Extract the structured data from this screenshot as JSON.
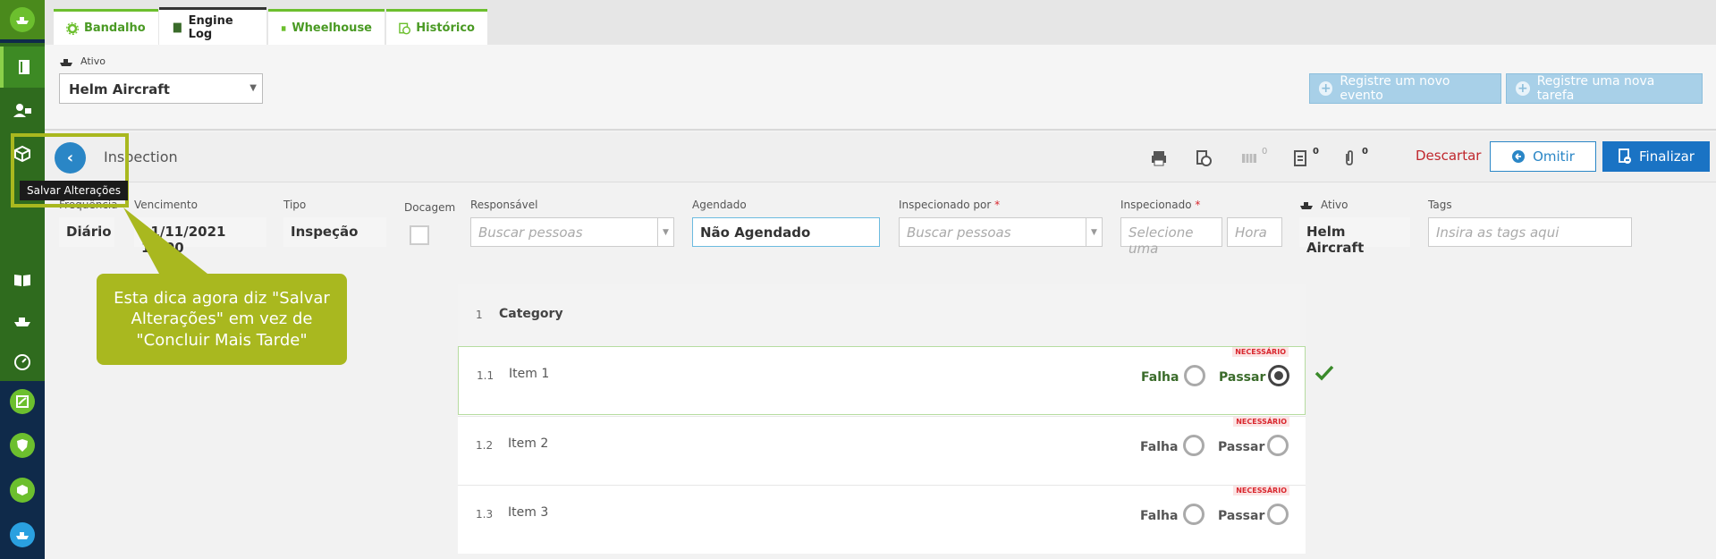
{
  "tabs": [
    {
      "label": "Bandalho",
      "icon": "gear-icon"
    },
    {
      "label": "Engine Log",
      "icon": "book-icon"
    },
    {
      "label": "Wheelhouse",
      "icon": "book-icon"
    },
    {
      "label": "Histórico",
      "icon": "history-icon"
    }
  ],
  "asset_bar": {
    "label": "Ativo",
    "selected": "Helm Aircraft",
    "new_event": "Registre um novo evento",
    "new_task": "Registre uma nova tarefa"
  },
  "header": {
    "title": "Inspection",
    "counts": [
      "0",
      "0",
      "0"
    ],
    "discard": "Descartar",
    "omit": "Omitir",
    "finish": "Finalizar"
  },
  "fields": {
    "freq_label": "Frequência",
    "freq_value": "Diário",
    "due_label": "Vencimento",
    "due_value": "11/11/2021 12:00",
    "type_label": "Tipo",
    "type_value": "Inspeção",
    "dock_label": "Docagem",
    "resp_label": "Responsável",
    "resp_placeholder": "Buscar pessoas",
    "sched_label": "Agendado",
    "sched_value": "Não Agendado",
    "inspby_label": "Inspecionado por",
    "inspby_placeholder": "Buscar pessoas",
    "insp_label": "Inspecionado",
    "insp_date_placeholder": "Selecione uma",
    "insp_time_placeholder": "Hora",
    "asset_label": "Ativo",
    "asset_value": "Helm Aircraft",
    "tags_label": "Tags",
    "tags_placeholder": "Insira as tags aqui",
    "required_mark": "*"
  },
  "checklist": {
    "category_num": "1",
    "category": "Category",
    "fail_label": "Falha",
    "pass_label": "Passar",
    "required": "NECESSÁRIO",
    "items": [
      {
        "num": "1.1",
        "name": "Item 1",
        "passed": true
      },
      {
        "num": "1.2",
        "name": "Item 2",
        "passed": false
      },
      {
        "num": "1.3",
        "name": "Item 3",
        "passed": false
      }
    ]
  },
  "tooltip": "Salvar Alterações",
  "callout": "Esta dica agora diz \"Salvar Alterações\" em vez de \"Concluir Mais Tarde\"",
  "colors": {
    "brand_green": "#6cbf2e",
    "primary_blue": "#1a73c4",
    "callout": "#a9b81f",
    "danger": "#c0272d"
  }
}
